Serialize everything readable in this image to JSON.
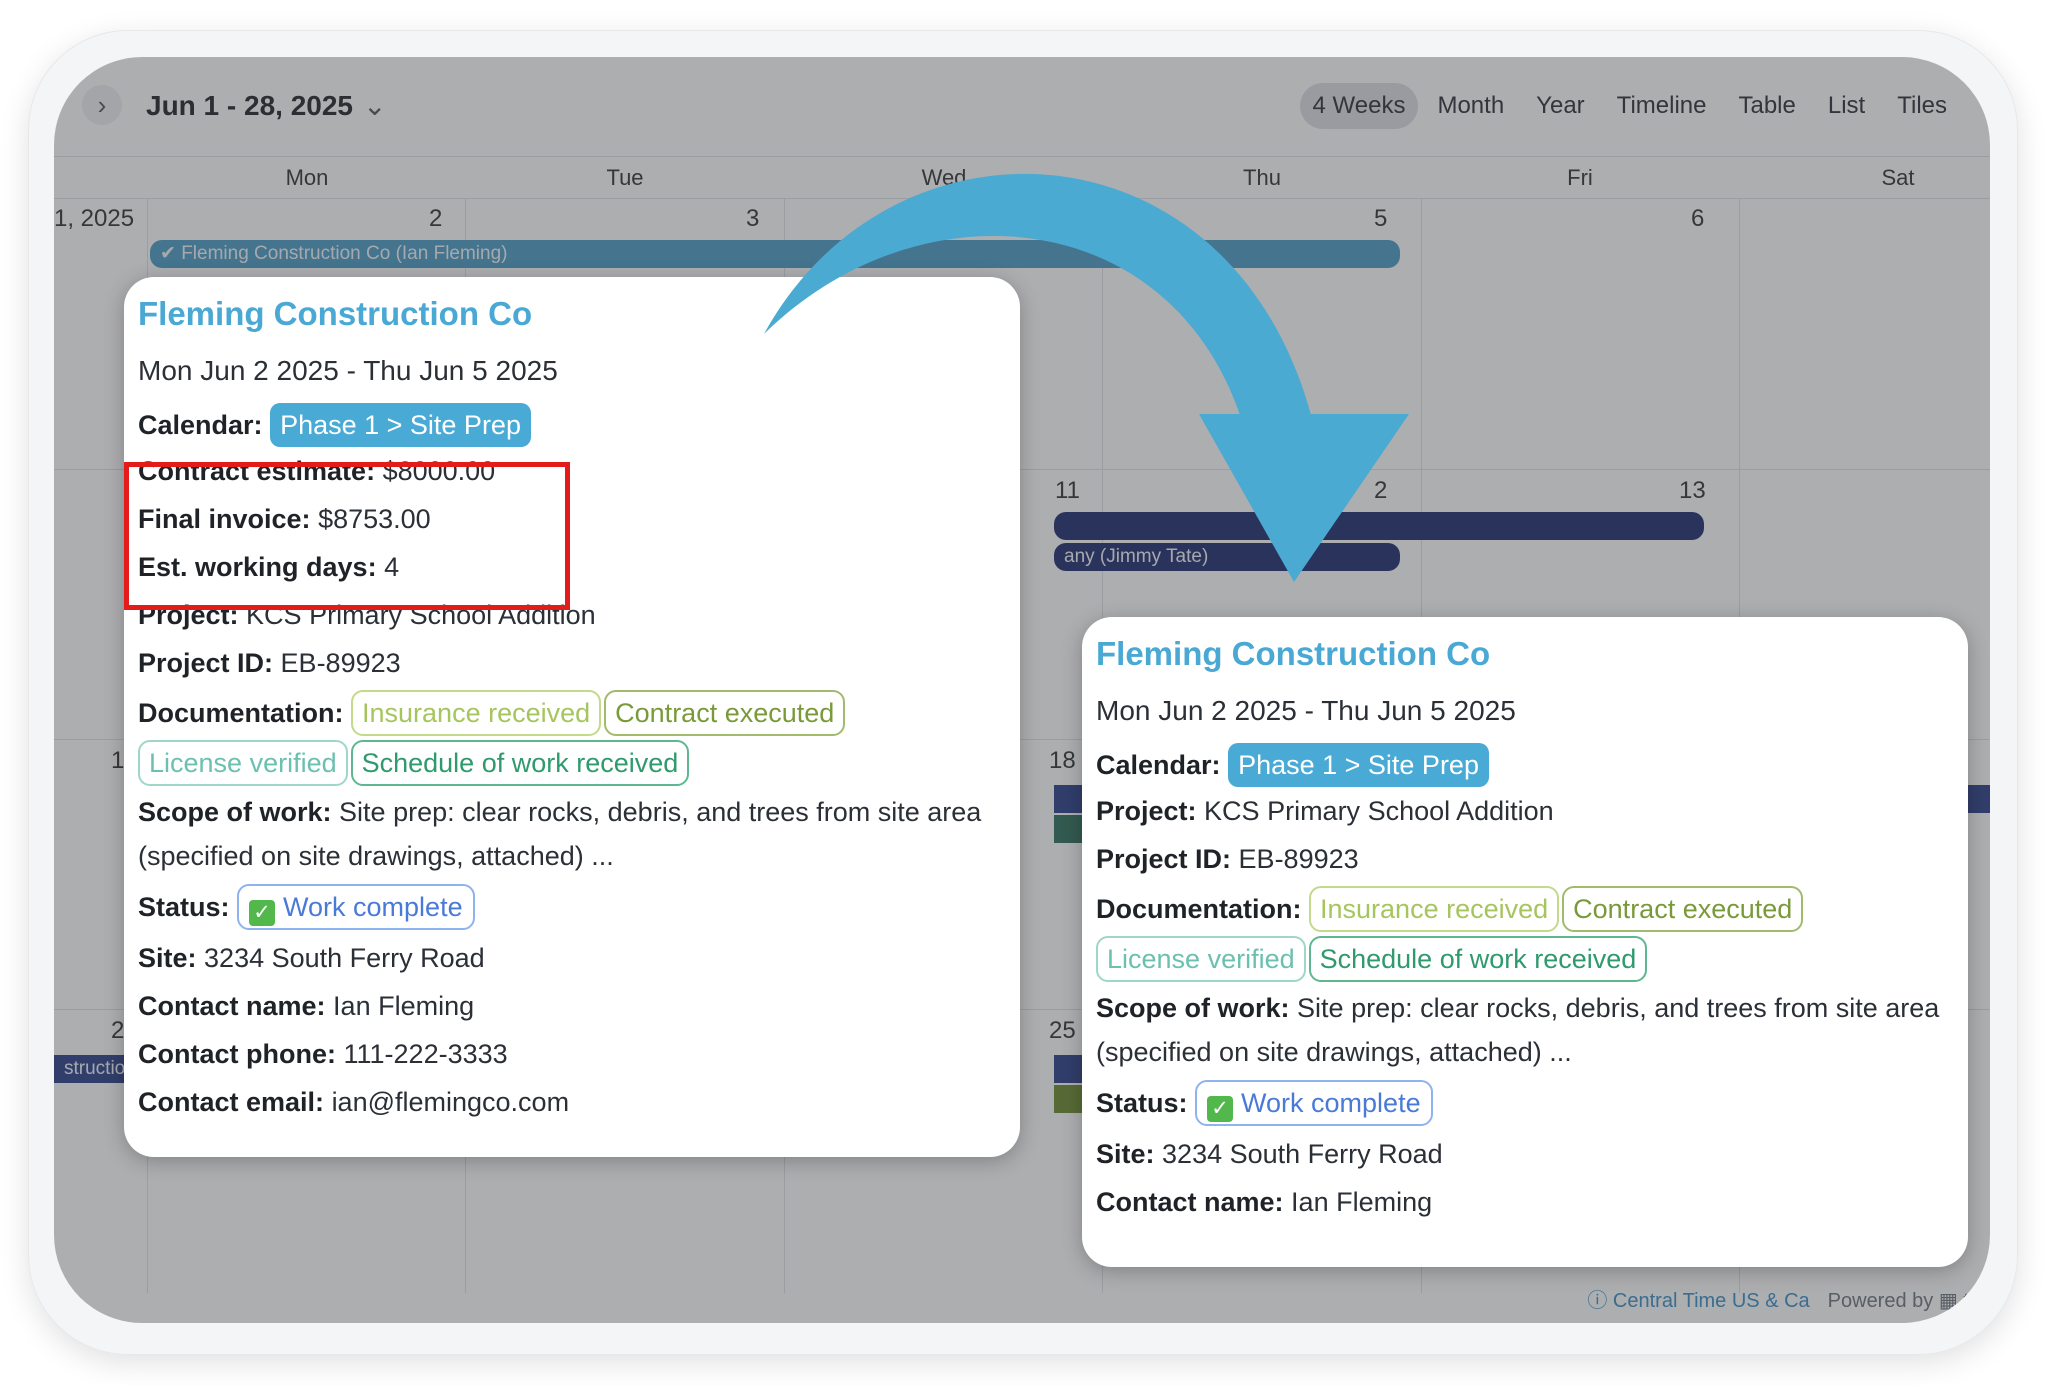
{
  "toolbar": {
    "range": "Jun 1 - 28, 2025",
    "views": [
      "4 Weeks",
      "Month",
      "Year",
      "Timeline",
      "Table",
      "List",
      "Tiles"
    ],
    "active_view": "4 Weeks"
  },
  "weekdays": [
    "Mon",
    "Tue",
    "Wed",
    "Thu",
    "Fri",
    "Sat"
  ],
  "grid": {
    "week1_first": "1, 2025",
    "dates": [
      "2",
      "3",
      "5",
      "6",
      "11",
      "2",
      "13",
      "1",
      "18",
      "2",
      "25"
    ]
  },
  "events": {
    "fleming_bar": "Fleming Construction Co (Ian Fleming)",
    "tate_bar": "any (Jimmy Tate)",
    "constr_bar": "structio"
  },
  "footer": {
    "timezone": "Central Time US & Ca",
    "powered": "Powered by",
    "brand": "te"
  },
  "card_full": {
    "title": "Fleming Construction Co",
    "dates": "Mon Jun 2 2025 - Thu Jun 5 2025",
    "calendar_label": "Calendar:",
    "calendar_value": "Phase 1 > Site Prep",
    "estimate_label": "Contract estimate:",
    "estimate_value": "$8000.00",
    "invoice_label": "Final invoice:",
    "invoice_value": "$8753.00",
    "days_label": "Est. working days:",
    "days_value": "4",
    "project_label": "Project:",
    "project_value": "KCS Primary School Addition",
    "projectid_label": "Project ID:",
    "projectid_value": "EB-89923",
    "doc_label": "Documentation:",
    "tags": [
      "Insurance received",
      "Contract executed",
      "License verified",
      "Schedule of work received"
    ],
    "scope_label": "Scope of work:",
    "scope_value": "Site prep: clear rocks, debris, and trees from site area (specified on site drawings, attached) ...",
    "status_label": "Status:",
    "status_value": "Work complete",
    "site_label": "Site:",
    "site_value": "3234 South Ferry Road",
    "contact_name_label": "Contact name:",
    "contact_name_value": "Ian Fleming",
    "contact_phone_label": "Contact phone:",
    "contact_phone_value": "111-222-3333",
    "contact_email_label": "Contact email:",
    "contact_email_value": "ian@flemingco.com"
  },
  "card_short": {
    "title": "Fleming Construction Co",
    "dates": "Mon Jun 2 2025 - Thu Jun 5 2025",
    "calendar_label": "Calendar:",
    "calendar_value": "Phase 1 > Site Prep",
    "project_label": "Project:",
    "project_value": "KCS Primary School Addition",
    "projectid_label": "Project ID:",
    "projectid_value": "EB-89923",
    "doc_label": "Documentation:",
    "tags": [
      "Insurance received",
      "Contract executed",
      "License verified",
      "Schedule of work received"
    ],
    "scope_label": "Scope of work:",
    "scope_value": "Site prep: clear rocks, debris, and trees from site area (specified on site drawings, attached) ...",
    "status_label": "Status:",
    "status_value": "Work complete",
    "site_label": "Site:",
    "site_value": "3234 South Ferry Road",
    "contact_name_label": "Contact name:",
    "contact_name_value": "Ian Fleming"
  },
  "colors": {
    "accent": "#4aa8d4",
    "highlight": "#e31b1b",
    "arrow": "#4aaad2"
  }
}
